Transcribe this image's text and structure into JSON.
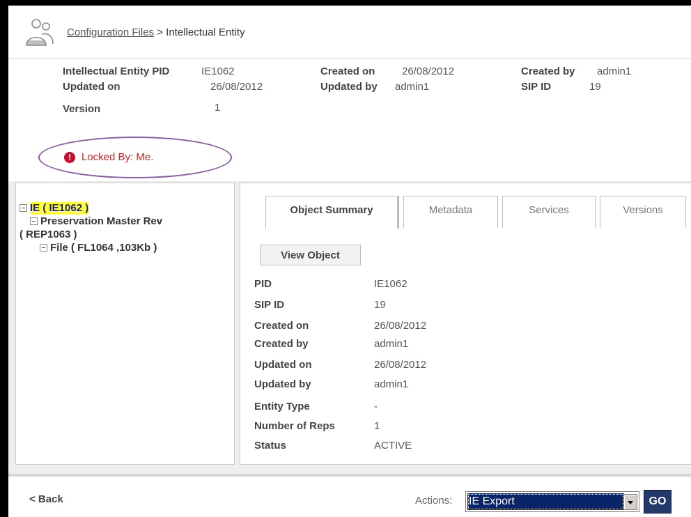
{
  "header": {
    "breadcrumb_link": "Configuration Files",
    "breadcrumb_sep": ">",
    "breadcrumb_current": "Intellectual Entity"
  },
  "info": {
    "pid_label": "Intellectual Entity PID",
    "pid_value": "IE1062",
    "created_on_label": "Created on",
    "created_on_value": "26/08/2012",
    "created_by_label": "Created by",
    "created_by_value": "admin1",
    "updated_on_label": "Updated on",
    "updated_on_value": "26/08/2012",
    "updated_by_label": "Updated by",
    "updated_by_value": "admin1",
    "sip_id_label": "SIP ID",
    "sip_id_value": "19",
    "version_label": "Version",
    "version_value": "1"
  },
  "lock": {
    "text": "Locked By: Me."
  },
  "tree": {
    "ie": "IE ( IE1062 )",
    "rep_line1": "Preservation Master Rev",
    "rep_line2": "( REP1063 )",
    "file": "File ( FL1064 ,103Kb )"
  },
  "tabs": [
    {
      "label": "Object Summary",
      "active": true
    },
    {
      "label": "Metadata"
    },
    {
      "label": "Services"
    },
    {
      "label": "Versions"
    }
  ],
  "view_object_label": "View Object",
  "summary": [
    {
      "label": "PID",
      "value": "IE1062"
    },
    {
      "label": "SIP ID",
      "value": "19"
    },
    {
      "label": "Created on",
      "value": "26/08/2012"
    },
    {
      "label": "Created by",
      "value": "admin1"
    },
    {
      "label": "Updated on",
      "value": "26/08/2012"
    },
    {
      "label": "Updated by",
      "value": "admin1"
    },
    {
      "label": "Entity Type",
      "value": "-"
    },
    {
      "label": "Number of Reps",
      "value": "1"
    },
    {
      "label": "Status",
      "value": "ACTIVE"
    }
  ],
  "footer": {
    "back_label": "< Back",
    "actions_label": "Actions:",
    "selected_action": "IE Export",
    "go_label": "GO"
  },
  "colors": {
    "highlight": "#ffff33",
    "lock_red": "#d42020",
    "lock_oval": "#8c5aa8",
    "go_button": "#23386b",
    "selection": "#0a246a"
  }
}
